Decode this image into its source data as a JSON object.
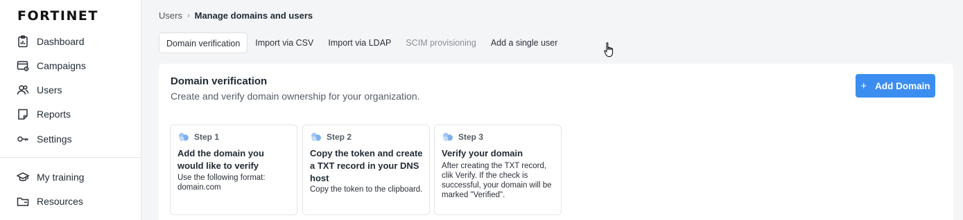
{
  "brand": {
    "logo_text": "FORTINET"
  },
  "sidebar": {
    "items": [
      {
        "label": "Dashboard",
        "icon": "dashboard-icon"
      },
      {
        "label": "Campaigns",
        "icon": "campaigns-icon"
      },
      {
        "label": "Users",
        "icon": "users-icon"
      },
      {
        "label": "Reports",
        "icon": "reports-icon"
      },
      {
        "label": "Settings",
        "icon": "settings-icon"
      }
    ],
    "secondary": [
      {
        "label": "My training",
        "icon": "graduation-cap-icon"
      },
      {
        "label": "Resources",
        "icon": "folder-icon"
      }
    ]
  },
  "breadcrumb": {
    "parent": "Users",
    "current": "Manage domains and users"
  },
  "tabs": [
    {
      "label": "Domain verification",
      "state": "active"
    },
    {
      "label": "Import via CSV",
      "state": "normal"
    },
    {
      "label": "Import via LDAP",
      "state": "normal"
    },
    {
      "label": "SCIM provisioning",
      "state": "disabled"
    },
    {
      "label": "Add a single user",
      "state": "normal"
    }
  ],
  "panel": {
    "title": "Domain verification",
    "subtitle": "Create and verify domain ownership for your organization.",
    "add_button": {
      "icon": "+",
      "label": "Add Domain"
    },
    "accent_color": "#3b8ef0"
  },
  "steps": [
    {
      "label": "Step 1",
      "title": "Add the domain you would like to verify",
      "description": "Use the following format: domain.com"
    },
    {
      "label": "Step 2",
      "title": "Copy the token and create a TXT record in your DNS host",
      "description": "Copy the token to the clipboard."
    },
    {
      "label": "Step 3",
      "title": "Verify your domain",
      "description": "After creating the TXT record, clik Verify. If the check is successful, your domain will be marked \"Verified\"."
    }
  ]
}
